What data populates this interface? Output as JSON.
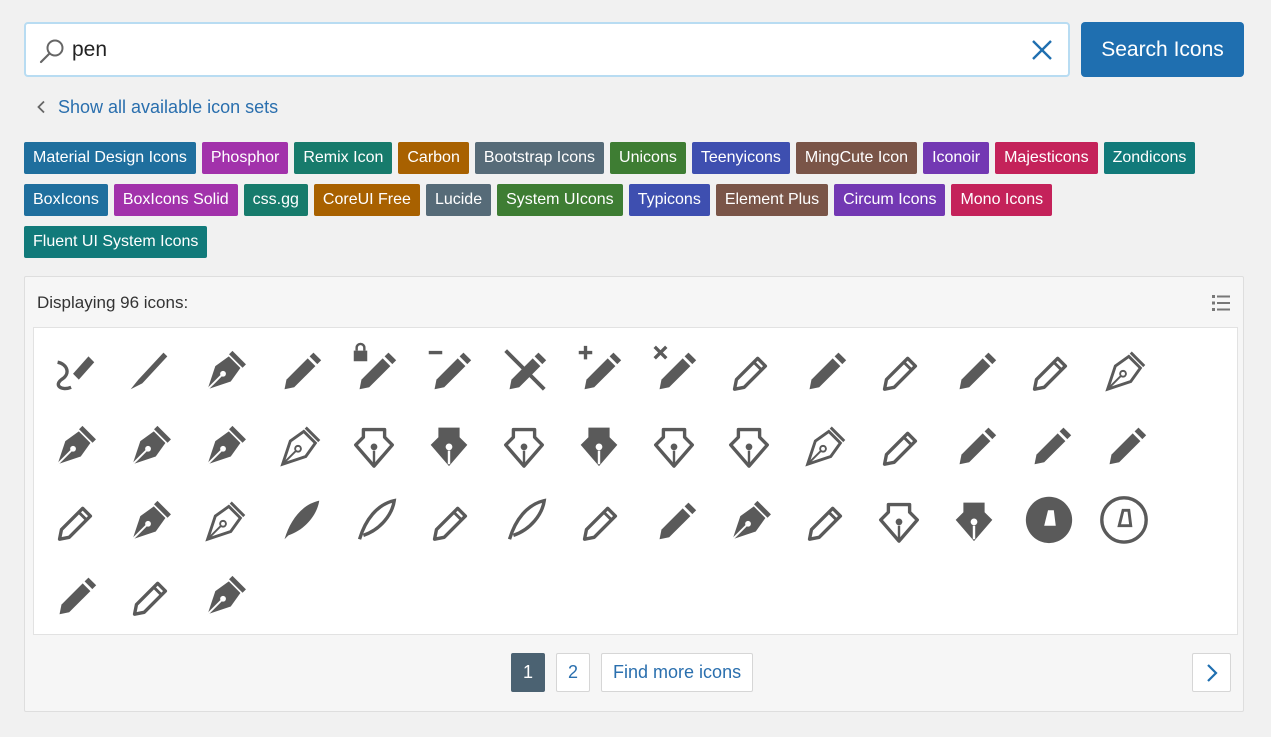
{
  "search": {
    "value": "pen",
    "button_label": "Search Icons"
  },
  "back_link": "Show all available icon sets",
  "tags": [
    [
      {
        "label": "Material Design Icons",
        "color": "#1f6f9e"
      },
      {
        "label": "Phosphor",
        "color": "#a232ab"
      },
      {
        "label": "Remix Icon",
        "color": "#177b6c"
      },
      {
        "label": "Carbon",
        "color": "#a86100"
      },
      {
        "label": "Bootstrap Icons",
        "color": "#566b78"
      },
      {
        "label": "Unicons",
        "color": "#3e7d33"
      },
      {
        "label": "Teenyicons",
        "color": "#3e4fb0"
      },
      {
        "label": "MingCute Icon",
        "color": "#7a5548"
      },
      {
        "label": "Iconoir",
        "color": "#7338b3"
      },
      {
        "label": "Majesticons",
        "color": "#c4225a"
      },
      {
        "label": "Zondicons",
        "color": "#117a7a"
      }
    ],
    [
      {
        "label": "BoxIcons",
        "color": "#1f6f9e"
      },
      {
        "label": "BoxIcons Solid",
        "color": "#a232ab"
      },
      {
        "label": "css.gg",
        "color": "#177b6c"
      },
      {
        "label": "CoreUI Free",
        "color": "#a86100"
      },
      {
        "label": "Lucide",
        "color": "#566b78"
      },
      {
        "label": "System UIcons",
        "color": "#3e7d33"
      },
      {
        "label": "Typicons",
        "color": "#3e4fb0"
      },
      {
        "label": "Element Plus",
        "color": "#7a5548"
      },
      {
        "label": "Circum Icons",
        "color": "#7338b3"
      },
      {
        "label": "Mono Icons",
        "color": "#c4225a"
      }
    ],
    [
      {
        "label": "Fluent UI System Icons",
        "color": "#117a7a"
      }
    ]
  ],
  "results": {
    "count_text": "Displaying 96 icons:",
    "icon_color": "#5a5a5a",
    "icons": [
      "pen-squiggle",
      "brush",
      "pen-nib",
      "pen-solid",
      "pen-lock",
      "pen-minus",
      "pen-off",
      "pen-plus",
      "pen-remove",
      "pencil-outline",
      "pencil-box",
      "pencil-outline-2",
      "pencil-solid",
      "pencil-thin",
      "pen-nib-outline",
      "pen-nib-circle-solid",
      "pen-nib-duotone",
      "pen-nib-bold",
      "pen-nib-light",
      "fountain-pen",
      "fountain-pen-fill",
      "fountain-pen-duotone",
      "fountain-pen-bold",
      "fountain-pen-line",
      "fountain-pen-thin",
      "pen-nib-thin",
      "pencil-thin-2",
      "pencil-bold",
      "pencil-striped",
      "marker",
      "highlighter",
      "pen-tool-fill",
      "pen-tool-line",
      "quill-fill",
      "quill-line",
      "pen-slash",
      "pen-tip",
      "pen-clip",
      "pen-fill-clip",
      "pen-nib-2",
      "pencil-2",
      "pen-nib-vertical",
      "pen-nib-vertical-fill",
      "pen-circle-fill",
      "pen-circle-outline",
      "pen-clip-solid",
      "pen-clip-outline",
      "pen-nib-fill-2"
    ]
  },
  "pagination": {
    "pages": [
      "1",
      "2"
    ],
    "active": "1",
    "more_label": "Find more icons"
  }
}
